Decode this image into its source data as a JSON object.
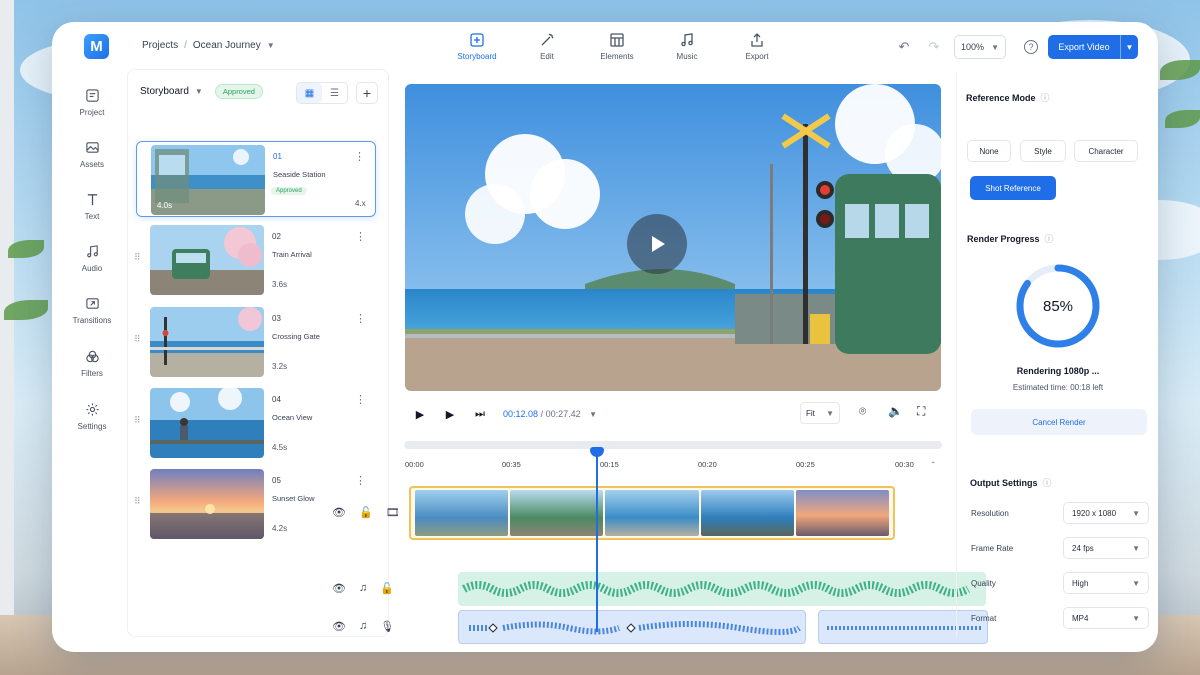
{
  "app": {
    "logo_letter": "M",
    "breadcrumb": {
      "root": "Projects",
      "separator": "/",
      "project": "Ocean Journey"
    },
    "tabs": [
      {
        "label": "Storyboard",
        "icon": "storyboard-icon"
      },
      {
        "label": "Edit",
        "icon": "magic-wand-icon"
      },
      {
        "label": "Elements",
        "icon": "elements-icon"
      },
      {
        "label": "Music",
        "icon": "music-note-icon"
      },
      {
        "label": "Export",
        "icon": "export-icon"
      }
    ],
    "active_tab": "Storyboard",
    "zoom": "100%",
    "export_label": "Export Video",
    "accent": "#1f6ee8"
  },
  "rail": [
    {
      "label": "Project",
      "icon": "project-icon"
    },
    {
      "label": "Assets",
      "icon": "image-icon"
    },
    {
      "label": "Text",
      "icon": "text-icon"
    },
    {
      "label": "Audio",
      "icon": "music-note-icon"
    },
    {
      "label": "Transitions",
      "icon": "transition-icon"
    },
    {
      "label": "Filters",
      "icon": "filters-icon"
    },
    {
      "label": "Settings",
      "icon": "gear-icon"
    }
  ],
  "storyboard": {
    "title": "Storyboard",
    "status_badge": "Approved",
    "shots": [
      {
        "num": "01",
        "title": "Seaside Station",
        "duration": "4.0s",
        "badge": "Approved",
        "side_duration": "4.x",
        "selected": true
      },
      {
        "num": "02",
        "title": "Train Arrival",
        "duration": "3.6s"
      },
      {
        "num": "03",
        "title": "Crossing Gate",
        "duration": "3.2s"
      },
      {
        "num": "04",
        "title": "Ocean View",
        "duration": "4.5s"
      },
      {
        "num": "05",
        "title": "Sunset Glow",
        "duration": "4.2s"
      }
    ]
  },
  "player": {
    "current_time": "00:12.08",
    "separator": "/",
    "total_time": "00:27.42",
    "fit": "Fit"
  },
  "timeline": {
    "ruler": [
      "00:00",
      "00:35",
      "00:15",
      "00:20",
      "00:25",
      "00:30"
    ],
    "playhead_position": 0.45
  },
  "reference": {
    "title": "Reference Mode",
    "modes": [
      "None",
      "Style",
      "Character"
    ],
    "shot_reference": "Shot Reference"
  },
  "render": {
    "title": "Render Progress",
    "percent_label": "85%",
    "progress": 0.85,
    "status": "Rendering 1080p ...",
    "eta": "Estimated time: 00:18 left",
    "cancel_label": "Cancel Render"
  },
  "output": {
    "title": "Output Settings",
    "rows": [
      {
        "label": "Resolution",
        "value": "1920 x 1080"
      },
      {
        "label": "Frame Rate",
        "value": "24 fps"
      },
      {
        "label": "Quality",
        "value": "High"
      },
      {
        "label": "Format",
        "value": "MP4"
      }
    ]
  }
}
